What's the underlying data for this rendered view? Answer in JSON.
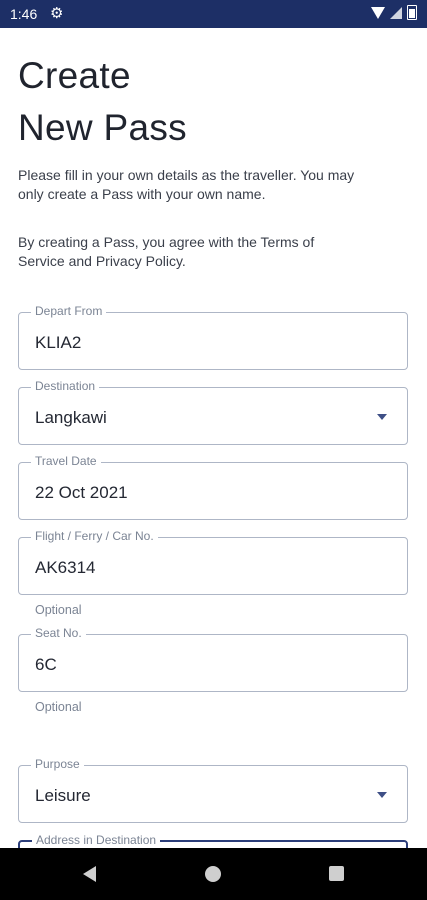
{
  "status_bar": {
    "time": "1:46",
    "icons": [
      "settings-icon",
      "wifi-icon",
      "signal-icon",
      "battery-icon"
    ]
  },
  "page": {
    "title_line1": "Create",
    "title_line2": "New Pass",
    "info1": "Please fill in your own details as the traveller. You may only create a Pass with your own name.",
    "info2": "By creating a Pass, you agree with the Terms of Service and Privacy Policy."
  },
  "form": {
    "depart_from": {
      "label": "Depart From",
      "value": "KLIA2"
    },
    "destination": {
      "label": "Destination",
      "value": "Langkawi"
    },
    "travel_date": {
      "label": "Travel Date",
      "value": "22 Oct 2021"
    },
    "transport_no": {
      "label": "Flight / Ferry / Car No.",
      "value": "AK6314",
      "helper": "Optional"
    },
    "seat_no": {
      "label": "Seat No.",
      "value": "6C",
      "helper": "Optional"
    },
    "purpose": {
      "label": "Purpose",
      "value": "Leisure"
    },
    "address": {
      "label": "Address in Destination",
      "value": ""
    }
  },
  "colors": {
    "status_bar": "#1d2f66",
    "accent": "#2c3e7a",
    "outline": "#aeb6c6",
    "nav_bar": "#000000"
  },
  "nav_bar": {
    "icons": [
      "back-icon",
      "home-icon",
      "recents-icon"
    ]
  }
}
